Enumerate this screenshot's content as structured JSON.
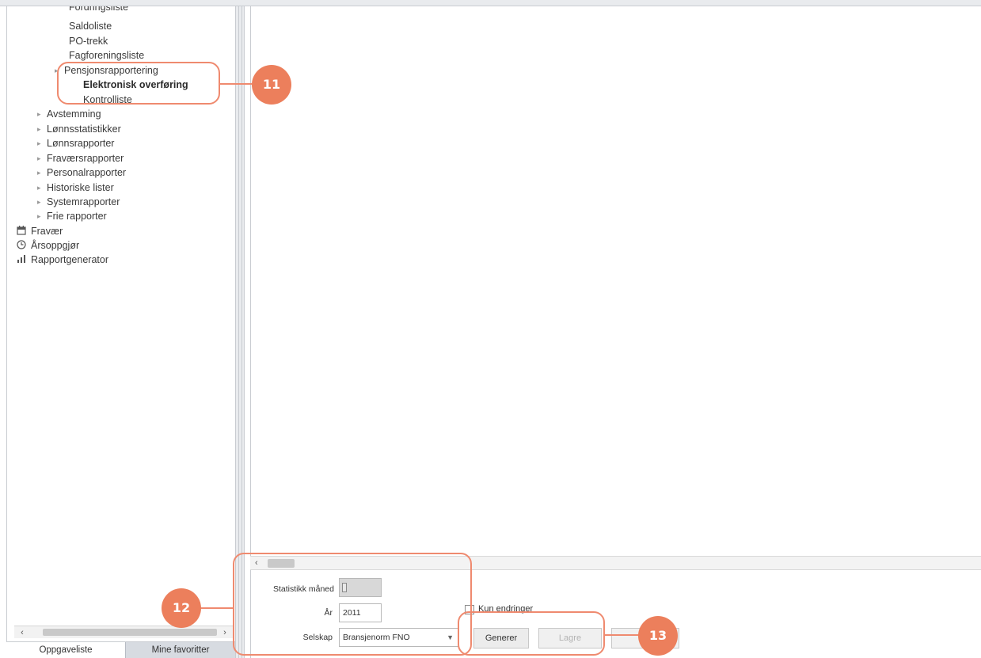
{
  "tree": {
    "items": [
      {
        "label": "Fordringsliste",
        "level": 2
      },
      {
        "label": "Saldoliste",
        "level": 2
      },
      {
        "label": "PO-trekk",
        "level": 2
      },
      {
        "label": "Fagforeningsliste",
        "level": 2
      },
      {
        "label": "Pensjonsrapportering",
        "level": 1,
        "expanded": true
      },
      {
        "label": "Elektronisk overføring",
        "level": 3,
        "selected": true
      },
      {
        "label": "Kontrolliste",
        "level": 3
      },
      {
        "label": "Avstemming",
        "level": 0
      },
      {
        "label": "Lønnsstatistikker",
        "level": 0
      },
      {
        "label": "Lønnsrapporter",
        "level": 0
      },
      {
        "label": "Fraværsrapporter",
        "level": 0
      },
      {
        "label": "Personalrapporter",
        "level": 0
      },
      {
        "label": "Historiske lister",
        "level": 0
      },
      {
        "label": "Systemrapporter",
        "level": 0
      },
      {
        "label": "Frie rapporter",
        "level": 0
      }
    ],
    "roots": [
      {
        "label": "Fravær",
        "icon": "calendar-icon"
      },
      {
        "label": "Årsoppgjør",
        "icon": "clock-icon"
      },
      {
        "label": "Rapportgenerator",
        "icon": "bar-chart-icon"
      }
    ]
  },
  "left_tabs": {
    "active": "Oppgaveliste",
    "inactive": "Mine favoritter"
  },
  "form": {
    "month_label": "Statistikk måned",
    "month_value": "",
    "year_label": "År",
    "year_value": "2011",
    "company_label": "Selskap",
    "company_value": "Bransjenorm FNO",
    "checkbox_label": "Kun endringer",
    "checkbox_checked": false,
    "generate_label": "Generer",
    "save_label": "Lagre"
  },
  "callouts": {
    "c11": "11",
    "c12": "12",
    "c13": "13"
  },
  "colors": {
    "accent": "#ec7f5c",
    "panel_border": "#c9ccd1"
  }
}
